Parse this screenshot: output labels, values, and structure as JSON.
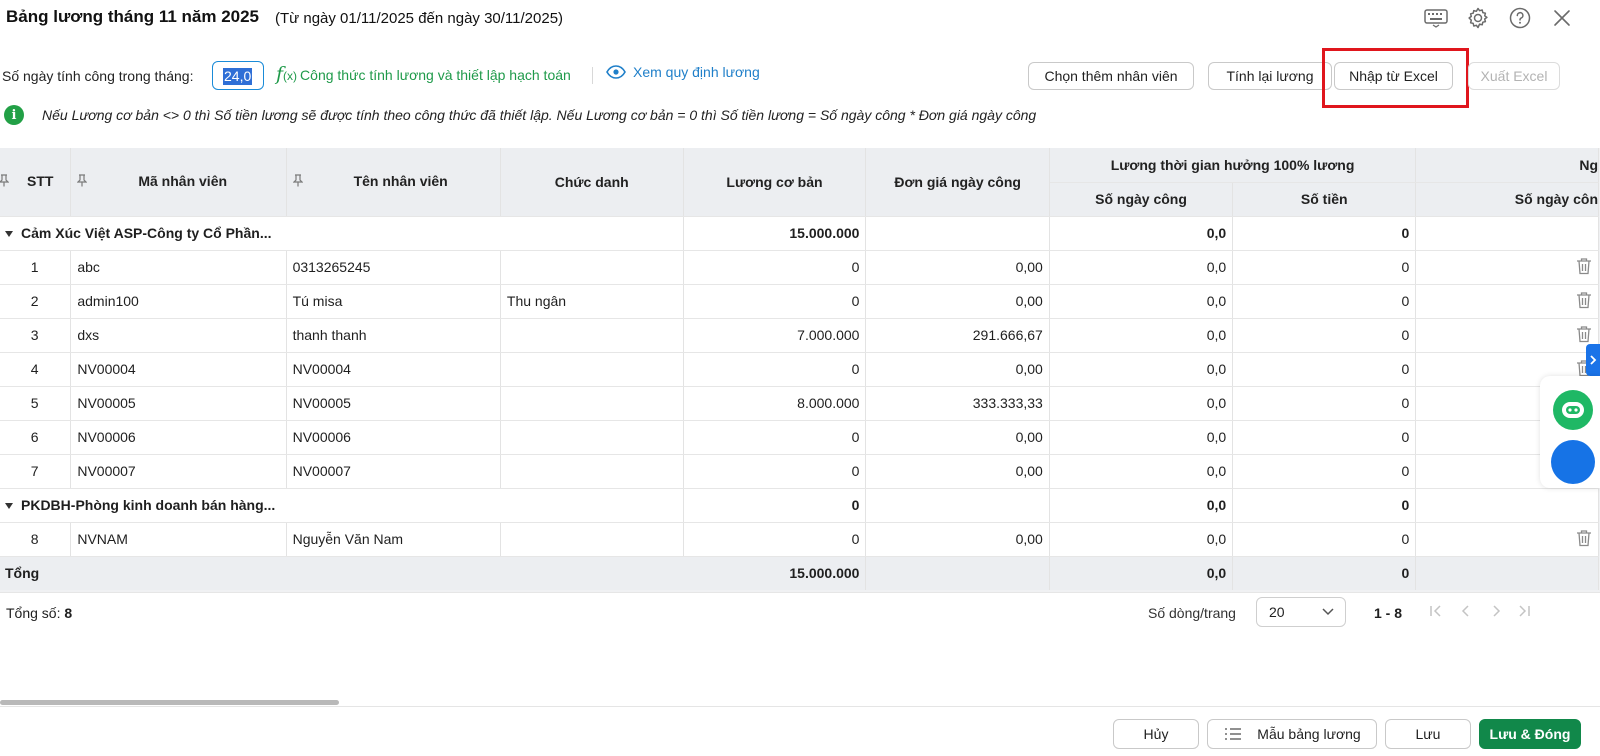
{
  "window": {
    "title": "Bảng lương tháng 11 năm 2025",
    "date_range": "(Từ ngày 01/11/2025 đến ngày 30/11/2025)"
  },
  "toolbar": {
    "days_label": "Số ngày tính công trong tháng:",
    "days_value": "24,0",
    "formula_link": "Công thức tính lương và thiết lập hạch toán",
    "view_rules_link": "Xem quy định lương",
    "add_employee": "Chọn thêm nhân viên",
    "recalc": "Tính lại lương",
    "import_excel": "Nhập từ Excel",
    "export_excel": "Xuất Excel"
  },
  "info": {
    "text": "Nếu Lương cơ bản <> 0 thì Số tiền lương sẽ được tính theo công thức đã thiết lập. Nếu Lương cơ bản = 0 thì Số tiền lương = Số ngày công * Đơn giá ngày công"
  },
  "table": {
    "headers": {
      "stt": "STT",
      "code": "Mã nhân viên",
      "name": "Tên nhân viên",
      "title": "Chức danh",
      "base": "Lương cơ bản",
      "daily": "Đơn giá ngày công",
      "group100": "Lương thời gian hưởng 100% lương",
      "days": "Số ngày công",
      "amount": "Số tiền",
      "next_group": "Ng",
      "next_days": "Số ngày côn"
    },
    "groups": [
      {
        "name": "Cảm Xúc Việt ASP-Công ty Cổ Phần...",
        "base": "15.000.000",
        "days": "0,0",
        "amount": "0",
        "rows": [
          {
            "stt": "1",
            "code": "abc",
            "name": "0313265245",
            "title": "",
            "base": "0",
            "daily": "0,00",
            "days": "0,0",
            "amount": "0"
          },
          {
            "stt": "2",
            "code": "admin100",
            "name": "Tú misa",
            "title": "Thu ngân",
            "base": "0",
            "daily": "0,00",
            "days": "0,0",
            "amount": "0"
          },
          {
            "stt": "3",
            "code": "dxs",
            "name": "thanh thanh",
            "title": "",
            "base": "7.000.000",
            "daily": "291.666,67",
            "days": "0,0",
            "amount": "0"
          },
          {
            "stt": "4",
            "code": "NV00004",
            "name": "NV00004",
            "title": "",
            "base": "0",
            "daily": "0,00",
            "days": "0,0",
            "amount": "0"
          },
          {
            "stt": "5",
            "code": "NV00005",
            "name": "NV00005",
            "title": "",
            "base": "8.000.000",
            "daily": "333.333,33",
            "days": "0,0",
            "amount": "0"
          },
          {
            "stt": "6",
            "code": "NV00006",
            "name": "NV00006",
            "title": "",
            "base": "0",
            "daily": "0,00",
            "days": "0,0",
            "amount": "0"
          },
          {
            "stt": "7",
            "code": "NV00007",
            "name": "NV00007",
            "title": "",
            "base": "0",
            "daily": "0,00",
            "days": "0,0",
            "amount": "0"
          }
        ]
      },
      {
        "name": "PKDBH-Phòng kinh doanh bán hàng...",
        "base": "0",
        "days": "0,0",
        "amount": "0",
        "rows": [
          {
            "stt": "8",
            "code": "NVNAM",
            "name": "Nguyễn Văn Nam",
            "title": "",
            "base": "0",
            "daily": "0,00",
            "days": "0,0",
            "amount": "0"
          }
        ]
      }
    ],
    "total": {
      "label": "Tổng",
      "base": "15.000.000",
      "days": "0,0",
      "amount": "0"
    }
  },
  "pager": {
    "total_label": "Tổng số:",
    "total_count": "8",
    "rows_label": "Số dòng/trang",
    "rows_value": "20",
    "range": "1 - 8"
  },
  "footer": {
    "cancel": "Hủy",
    "template": "Mẫu bảng lương",
    "save": "Lưu",
    "save_close": "Lưu & Đóng"
  },
  "colors": {
    "primary_green": "#11884a",
    "link_green": "#1f9a4a",
    "link_blue": "#1f7fc9",
    "highlight_red": "#e0161d",
    "header_bg": "#eceef1"
  }
}
